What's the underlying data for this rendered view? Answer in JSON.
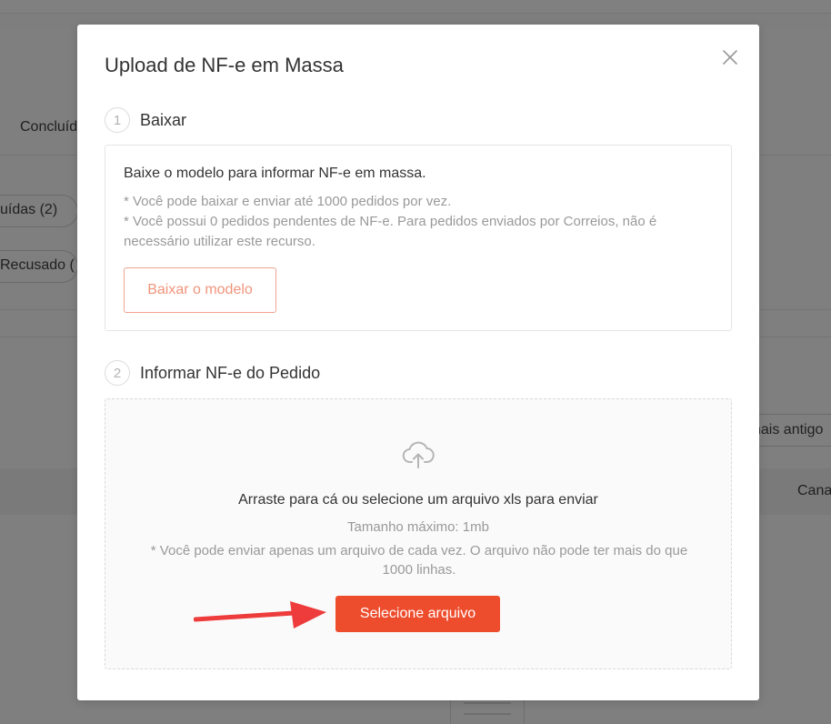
{
  "background": {
    "tab_label": "Concluíd",
    "filter_pill": "uídas (2)",
    "status_pill": "Recusado (",
    "right_text": "nais antigo",
    "right_header": "Cana"
  },
  "modal": {
    "title": "Upload de NF-e em Massa",
    "close_icon": "close-icon",
    "step1": {
      "number": "1",
      "title": "Baixar",
      "heading": "Baixe o modelo para informar NF-e em massa.",
      "note1": "* Você pode baixar e enviar até 1000 pedidos por vez.",
      "note2": "* Você possui 0 pedidos pendentes de NF-e. Para pedidos enviados por Correios, não é necessário utilizar este recurso.",
      "button": "Baixar o modelo"
    },
    "step2": {
      "number": "2",
      "title": "Informar NF-e do Pedido",
      "upload_icon": "cloud-upload-icon",
      "drop_title": "Arraste para cá ou selecione um arquivo xls para enviar",
      "max_size": "Tamanho máximo: 1mb",
      "note": "* Você pode enviar apenas um arquivo de cada vez. O arquivo não pode ter mais do que 1000 linhas.",
      "button": "Selecione arquivo"
    }
  },
  "colors": {
    "accent": "#ee4d2d",
    "accent_outline": "#f0947c",
    "annotation_arrow": "#ee3b3b"
  }
}
